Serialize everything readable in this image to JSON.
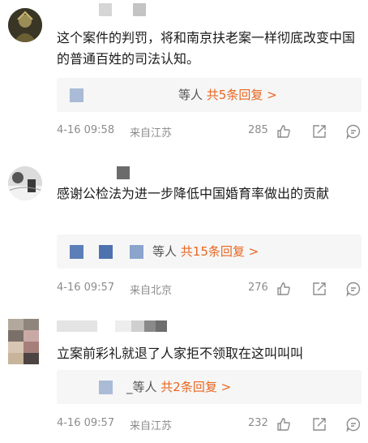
{
  "comments": [
    {
      "text": "这个案件的判罚，将和南京扶老案一样彻底改变中国的普通百姓的司法认知。",
      "reply_summary_prefix": "等人",
      "reply_count_link": "共5条回复 >",
      "date": "4-16 09:58",
      "location": "来自江苏",
      "likes": "285"
    },
    {
      "text": "感谢公检法为进一步降低中国婚育率做出的贡献",
      "reply_summary_prefix": "等人",
      "reply_count_link": "共15条回复 >",
      "date": "4-16 09:57",
      "location": "来自北京",
      "likes": "276"
    },
    {
      "text": "立案前彩礼就退了人家拒不领取在这叫叫叫",
      "reply_summary_prefix": "_等人",
      "reply_count_link": "共2条回复 >",
      "date": "4-16 09:57",
      "location": "来自江苏",
      "likes": "232"
    }
  ],
  "icons": {
    "like": "thumbs-up-icon",
    "share": "share-icon",
    "comment": "comment-icon"
  },
  "colors": {
    "accent": "#e86722",
    "meta_text": "#8c8c8c",
    "reply_bg": "#f6f6f6",
    "censor_blue": "#5c7fb7"
  }
}
